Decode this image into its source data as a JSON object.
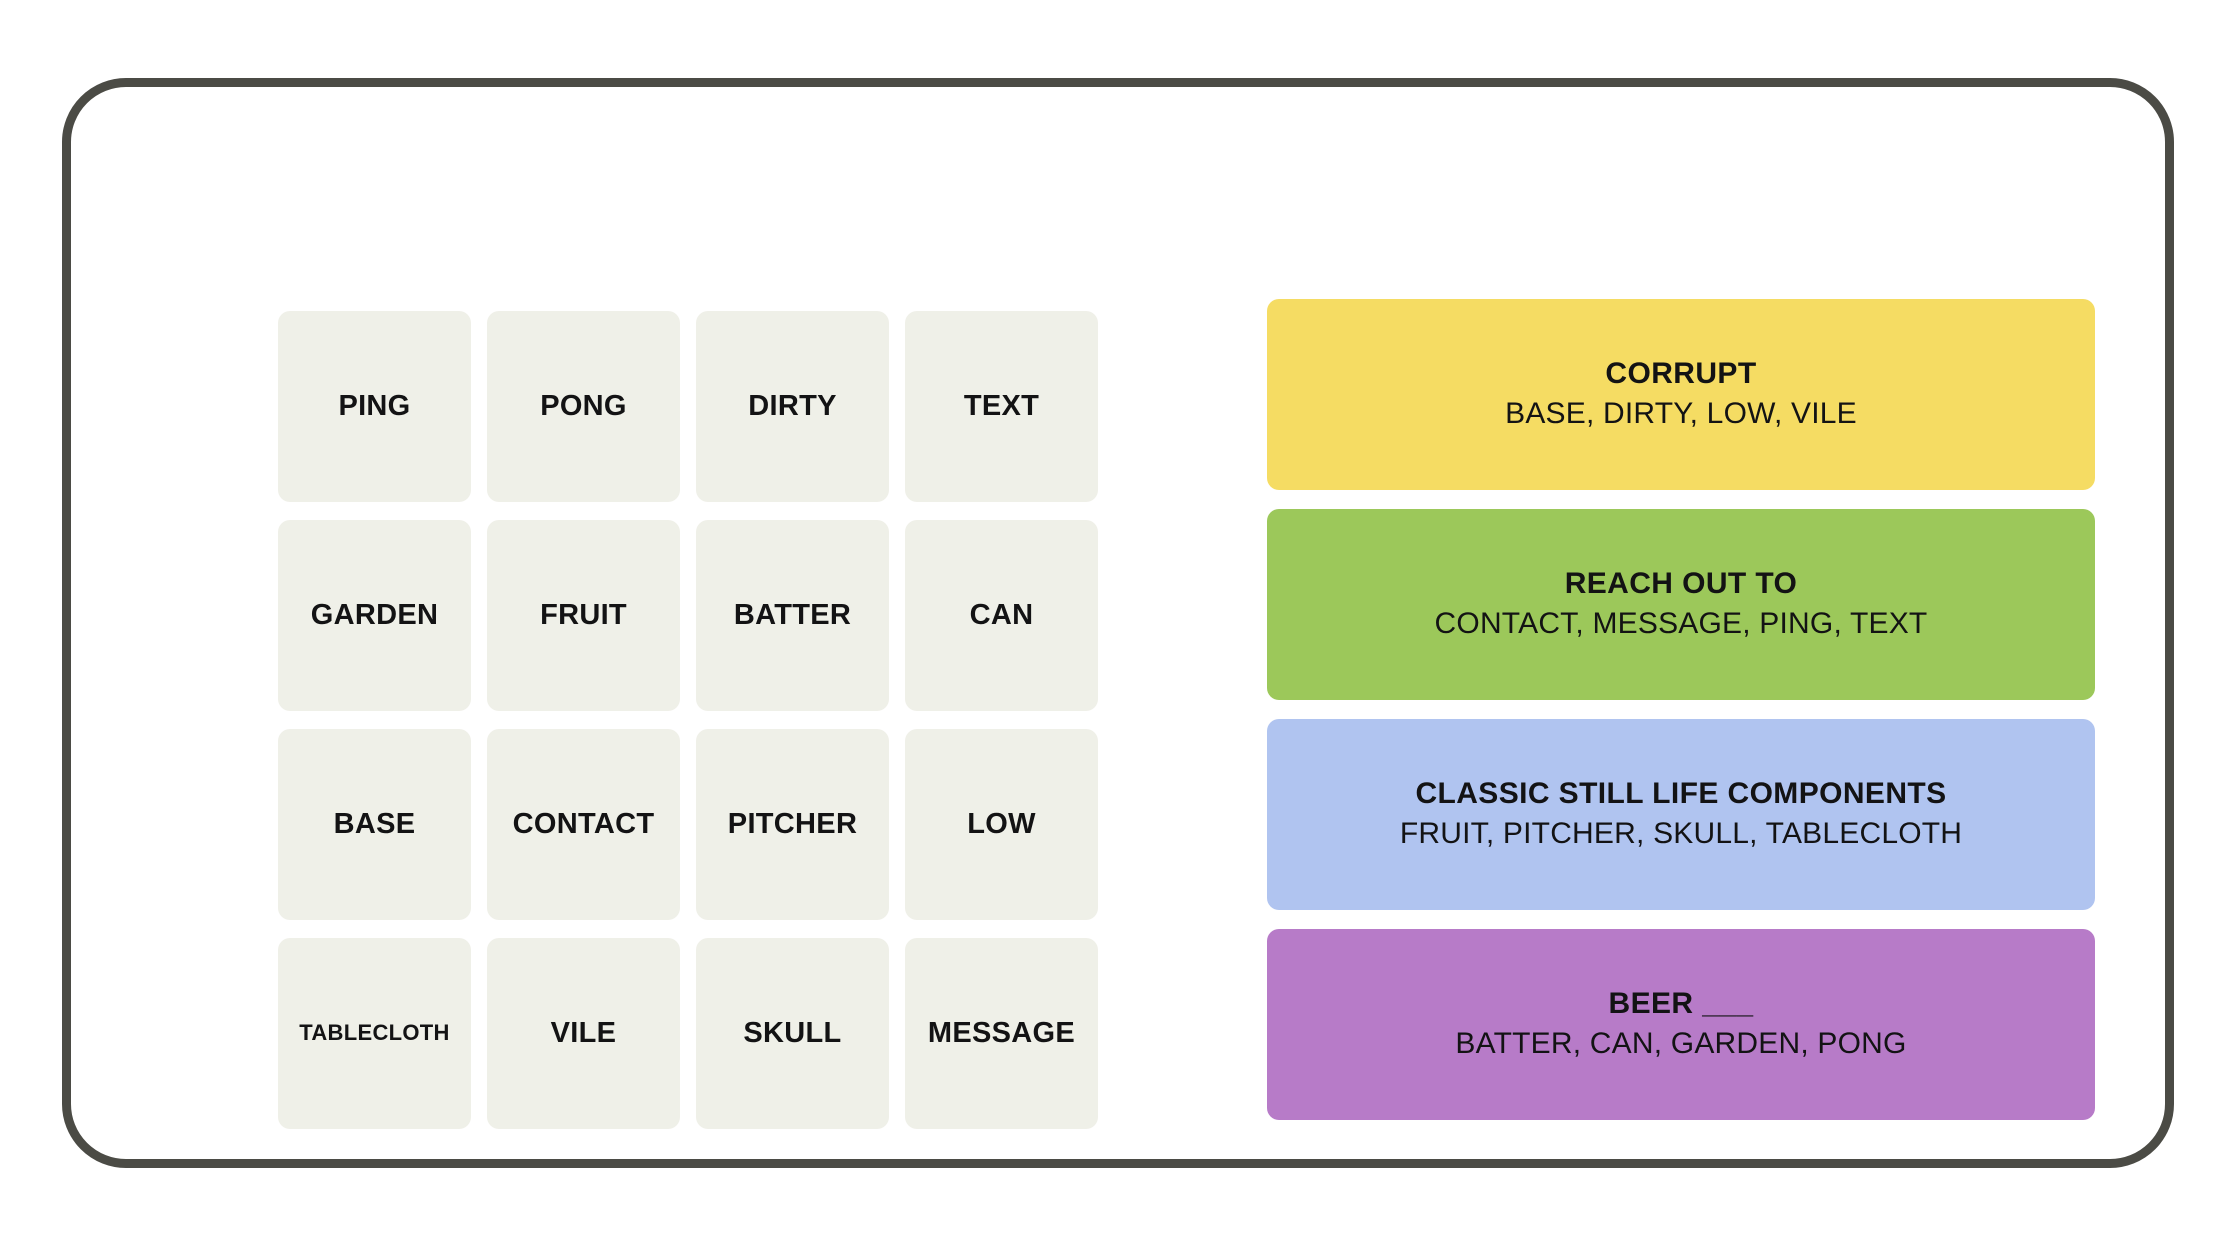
{
  "frame": {
    "border_color": "#4b4b45"
  },
  "board": {
    "tile_background": "#eff0e8",
    "text_color": "#131314",
    "rows": [
      [
        {
          "label": "PING",
          "small": false
        },
        {
          "label": "PONG",
          "small": false
        },
        {
          "label": "DIRTY",
          "small": false
        },
        {
          "label": "TEXT",
          "small": false
        }
      ],
      [
        {
          "label": "GARDEN",
          "small": false
        },
        {
          "label": "FRUIT",
          "small": false
        },
        {
          "label": "BATTER",
          "small": false
        },
        {
          "label": "CAN",
          "small": false
        }
      ],
      [
        {
          "label": "BASE",
          "small": false
        },
        {
          "label": "CONTACT",
          "small": false
        },
        {
          "label": "PITCHER",
          "small": false
        },
        {
          "label": "LOW",
          "small": false
        }
      ],
      [
        {
          "label": "TABLECLOTH",
          "small": true
        },
        {
          "label": "VILE",
          "small": false
        },
        {
          "label": "SKULL",
          "small": false
        },
        {
          "label": "MESSAGE",
          "small": false
        }
      ]
    ]
  },
  "solutions": [
    {
      "title": "CORRUPT",
      "words": "BASE, DIRTY, LOW, VILE",
      "color": "#f5dc63",
      "difficulty": "yellow"
    },
    {
      "title": "REACH OUT TO",
      "words": "CONTACT, MESSAGE, PING, TEXT",
      "color": "#9cc85a",
      "difficulty": "green"
    },
    {
      "title": "CLASSIC STILL LIFE COMPONENTS",
      "words": "FRUIT, PITCHER, SKULL, TABLECLOTH",
      "color": "#b0c4f0",
      "difficulty": "blue"
    },
    {
      "title": "BEER ___",
      "words": "BATTER, CAN, GARDEN, PONG",
      "color": "#b77bc8",
      "difficulty": "purple"
    }
  ]
}
